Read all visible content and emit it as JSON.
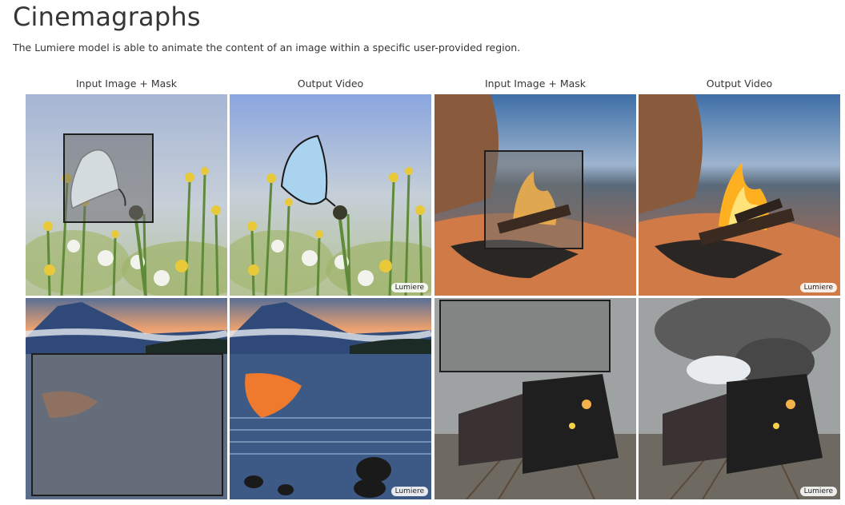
{
  "header": {
    "title": "Cinemagraphs",
    "description": "The Lumiere model is able to animate the content of an image within a specific user-provided region."
  },
  "columns": {
    "input_label": "Input Image + Mask",
    "output_label": "Output Video"
  },
  "badge_label": "Lumiere",
  "examples": [
    {
      "subject": "butterfly",
      "input_icon": "butterfly-image",
      "output_icon": "butterfly-video"
    },
    {
      "subject": "campfire",
      "input_icon": "campfire-image",
      "output_icon": "campfire-video"
    },
    {
      "subject": "lake",
      "input_icon": "lake-image",
      "output_icon": "lake-video"
    },
    {
      "subject": "train",
      "input_icon": "train-image",
      "output_icon": "train-video"
    }
  ]
}
